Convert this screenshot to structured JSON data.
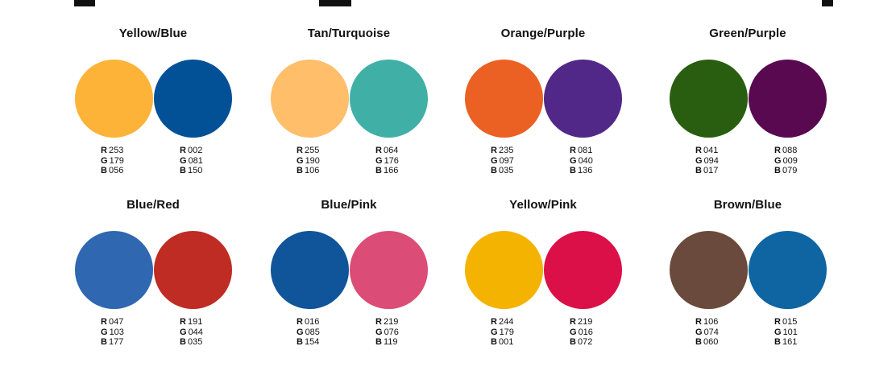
{
  "pairs": [
    {
      "title": "Yellow/Blue",
      "left": {
        "color": "#FDB338",
        "r": "253",
        "g": "179",
        "b": "056"
      },
      "right": {
        "color": "#025196",
        "r": "002",
        "g": "081",
        "b": "150"
      }
    },
    {
      "title": "Tan/Turquoise",
      "left": {
        "color": "#FFBE6A",
        "r": "255",
        "g": "190",
        "b": "106"
      },
      "right": {
        "color": "#40B0A6",
        "r": "064",
        "g": "176",
        "b": "166"
      }
    },
    {
      "title": "Orange/Purple",
      "left": {
        "color": "#EB6123",
        "r": "235",
        "g": "097",
        "b": "035"
      },
      "right": {
        "color": "#512888",
        "r": "081",
        "g": "040",
        "b": "136"
      }
    },
    {
      "title": "Green/Purple",
      "left": {
        "color": "#295E11",
        "r": "041",
        "g": "094",
        "b": "017"
      },
      "right": {
        "color": "#58094F",
        "r": "088",
        "g": "009",
        "b": "079"
      }
    },
    {
      "title": "Blue/Red",
      "left": {
        "color": "#2F67B1",
        "r": "047",
        "g": "103",
        "b": "177"
      },
      "right": {
        "color": "#BF2C23",
        "r": "191",
        "g": "044",
        "b": "035"
      }
    },
    {
      "title": "Blue/Pink",
      "left": {
        "color": "#10559A",
        "r": "016",
        "g": "085",
        "b": "154"
      },
      "right": {
        "color": "#DB4C77",
        "r": "219",
        "g": "076",
        "b": "119"
      }
    },
    {
      "title": "Yellow/Pink",
      "left": {
        "color": "#F4B301",
        "r": "244",
        "g": "179",
        "b": "001"
      },
      "right": {
        "color": "#DB1048",
        "r": "219",
        "g": "016",
        "b": "072"
      }
    },
    {
      "title": "Brown/Blue",
      "left": {
        "color": "#6A4A3C",
        "r": "106",
        "g": "074",
        "b": "060"
      },
      "right": {
        "color": "#0F65A1",
        "r": "015",
        "g": "101",
        "b": "161"
      }
    }
  ],
  "labels": {
    "r": "R",
    "g": "G",
    "b": "B"
  }
}
